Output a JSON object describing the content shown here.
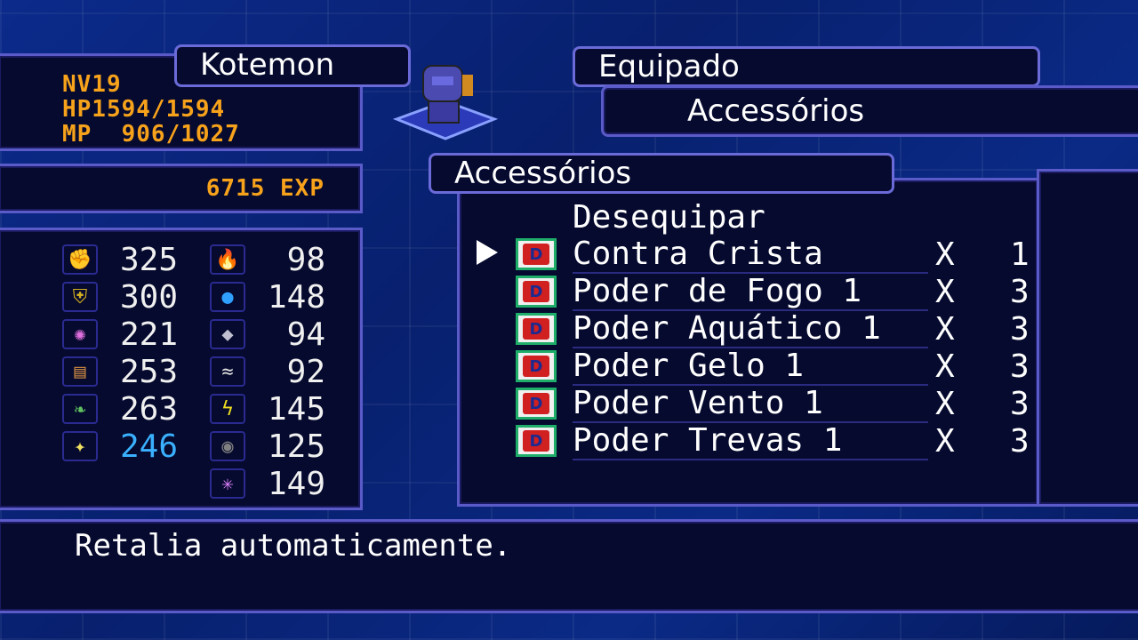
{
  "character": {
    "name": "Kotemon",
    "level": "NV19",
    "hp": "HP1594/1594",
    "mp": "MP  906/1027",
    "exp": "6715 EXP"
  },
  "stats_left": [
    {
      "icon": "fist-icon",
      "value": "325"
    },
    {
      "icon": "shield-icon",
      "value": "300"
    },
    {
      "icon": "spirit-icon",
      "value": "221"
    },
    {
      "icon": "book-icon",
      "value": "253"
    },
    {
      "icon": "feather-icon",
      "value": "263"
    },
    {
      "icon": "sparkle-icon",
      "value": "246",
      "color": "#3ab0ff"
    }
  ],
  "stats_right": [
    {
      "icon": "fire-icon",
      "value": "98"
    },
    {
      "icon": "water-icon",
      "value": "148"
    },
    {
      "icon": "ice-icon",
      "value": "94"
    },
    {
      "icon": "wind-icon",
      "value": "92"
    },
    {
      "icon": "thunder-icon",
      "value": "145"
    },
    {
      "icon": "darkness-icon",
      "value": "125"
    },
    {
      "icon": "light-icon",
      "value": "149"
    }
  ],
  "equipped": {
    "header": "Equipado",
    "slot": "Accessórios"
  },
  "list": {
    "header": "Accessórios",
    "unequip": "Desequipar",
    "items": [
      {
        "name": "Contra Crista",
        "x": "X",
        "qty": "1",
        "selected": true
      },
      {
        "name": "Poder de Fogo 1",
        "x": "X",
        "qty": "3"
      },
      {
        "name": "Poder Aquático 1",
        "x": "X",
        "qty": "3"
      },
      {
        "name": "Poder Gelo 1",
        "x": "X",
        "qty": "3"
      },
      {
        "name": "Poder Vento 1",
        "x": "X",
        "qty": "3"
      },
      {
        "name": "Poder Trevas 1",
        "x": "X",
        "qty": "3"
      }
    ]
  },
  "description": "Retalia automaticamente."
}
